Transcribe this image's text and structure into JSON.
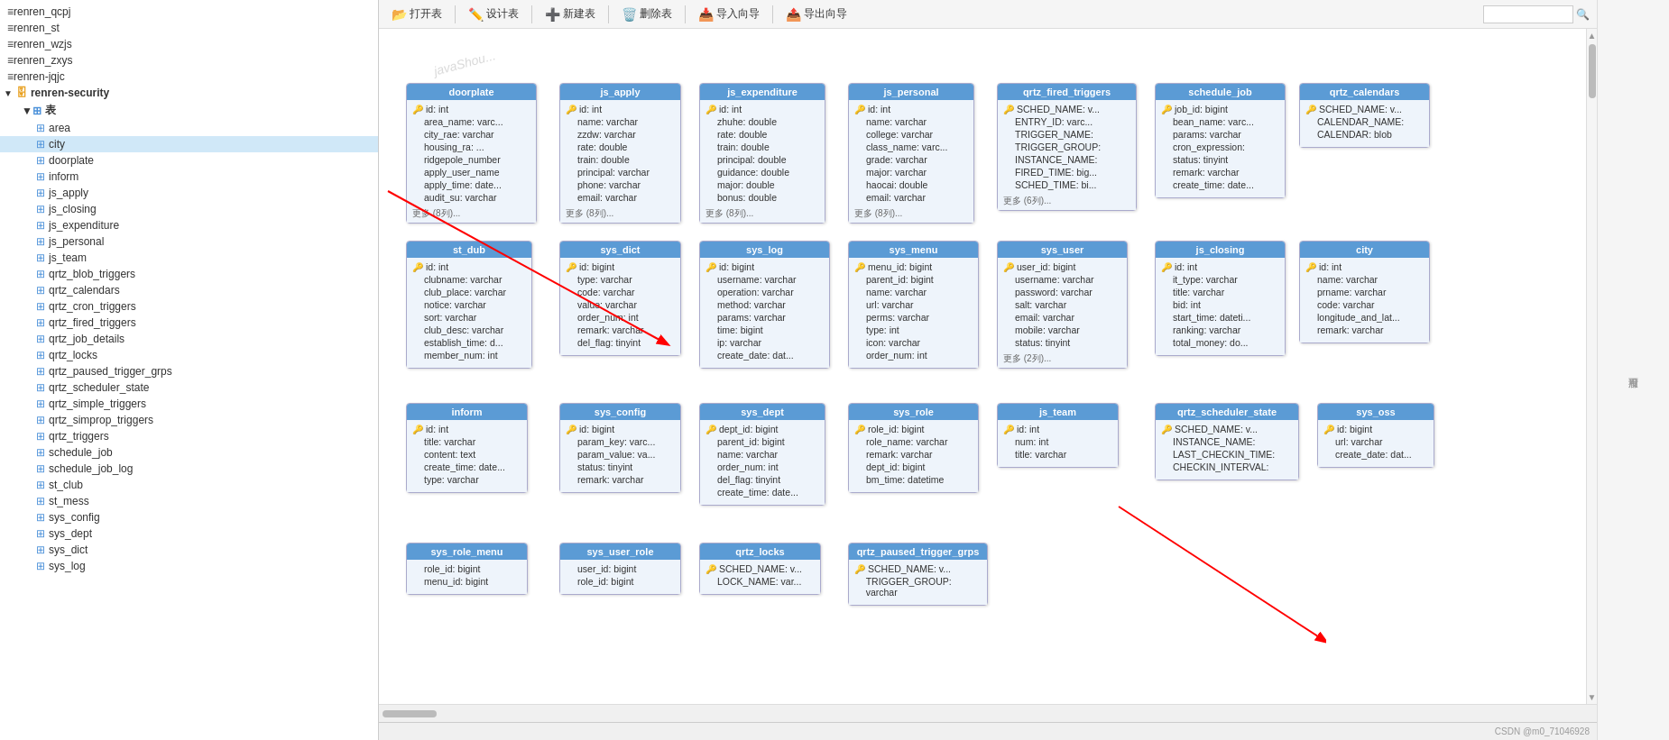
{
  "toolbar": {
    "open_table": "打开表",
    "design_table": "设计表",
    "new_table": "新建表",
    "delete_table": "删除表",
    "import_wizard": "导入向导",
    "export_wizard": "导出向导"
  },
  "sidebar": {
    "tables_label": "表",
    "db_name": "renren-security",
    "items": [
      "renren_qcpj",
      "renren_st",
      "renren_wzjs",
      "renren_zxys",
      "renren-jqjc",
      "renren-security",
      "area",
      "city",
      "doorplate",
      "inform",
      "js_apply",
      "js_closing",
      "js_expenditure",
      "js_personal",
      "js_team",
      "qrtz_blob_triggers",
      "qrtz_calendars",
      "qrtz_cron_triggers",
      "qrtz_fired_triggers",
      "qrtz_job_details",
      "qrtz_locks",
      "qrtz_paused_trigger_grps",
      "qrtz_scheduler_state",
      "qrtz_simple_triggers",
      "qrtz_simprop_triggers",
      "qrtz_triggers",
      "schedule_job",
      "schedule_job_log",
      "st_club",
      "st_mess",
      "sys_config",
      "sys_dept",
      "sys_dict",
      "sys_log"
    ]
  },
  "right_panel": {
    "text": "没有可用"
  },
  "tables": {
    "doorplate": {
      "name": "doorplate",
      "fields": [
        "id: int",
        "area_name: varc...",
        "city_rae: varchar",
        "housing_ra: ...",
        "ridgepole_number",
        "apply_user_name",
        "apply_time: date...",
        "audit_su: varchar"
      ],
      "more": "更多 (8列)..."
    },
    "js_apply": {
      "name": "js_apply",
      "fields": [
        "id: int",
        "name: varchar",
        "zzdw: varchar",
        "rate: double",
        "train: double",
        "principal: varchar",
        "phone: varchar",
        "email: varchar"
      ],
      "more": "更多 (8列)..."
    },
    "js_expenditure": {
      "name": "js_expenditure",
      "fields": [
        "id: int",
        "zhuhe: double",
        "rate: double",
        "train: double",
        "principal: double",
        "guidance: double",
        "major: double",
        "bonus: double"
      ],
      "more": "更多 (8列)..."
    },
    "js_personal": {
      "name": "js_personal",
      "fields": [
        "id: int",
        "name: varchar",
        "college: varchar",
        "class_name: varc...",
        "grade: varchar",
        "major: varchar",
        "haocai: double",
        "email: varchar"
      ],
      "more": "更多 (8列)..."
    },
    "qrtz_fired_triggers": {
      "name": "qrtz_fired_triggers",
      "fields": [
        "SCHED_NAME: v...",
        "ENTRY_ID: varc...",
        "TRIGGER_NAME:",
        "TRIGGER_GROUP:",
        "INSTANCE_NAME:",
        "FIRED_TIME: big...",
        "SCHED_TIME: bi..."
      ],
      "more": "更多 (6列)..."
    },
    "schedule_job": {
      "name": "schedule_job",
      "fields": [
        "job_id: bigint",
        "bean_name: varc...",
        "params: varchar",
        "cron_expression:",
        "status: tinyint",
        "remark: varchar",
        "create_time: date..."
      ],
      "more": ""
    },
    "qrtz_calendars": {
      "name": "qrtz_calendars",
      "fields": [
        "SCHED_NAME: v...",
        "CALENDAR_NAME:",
        "CALENDAR: blob"
      ],
      "more": ""
    },
    "st_dub": {
      "name": "st_dub",
      "fields": [
        "id: int",
        "clubname: varchar",
        "club_place: varchar",
        "notice: varchar",
        "sort: varchar",
        "club_desc: varchar",
        "establish_time: d...",
        "member_num: int"
      ],
      "more": ""
    },
    "sys_dict": {
      "name": "sys_dict",
      "fields": [
        "id: bigint",
        "type: varchar",
        "code: varchar",
        "value: varchar",
        "order_num: int",
        "remark: varchar",
        "del_flag: tinyint"
      ],
      "more": ""
    },
    "sys_log": {
      "name": "sys_log",
      "fields": [
        "id: bigint",
        "username: varchar",
        "operation: varchar",
        "method: varchar",
        "params: varchar",
        "time: bigint",
        "ip: varchar",
        "create_date: dat..."
      ],
      "more": ""
    },
    "sys_menu": {
      "name": "sys_menu",
      "fields": [
        "menu_id: bigint",
        "parent_id: bigint",
        "name: varchar",
        "url: varchar",
        "perms: varchar",
        "type: int",
        "icon: varchar",
        "order_num: int"
      ],
      "more": ""
    },
    "sys_user": {
      "name": "sys_user",
      "fields": [
        "user_id: bigint",
        "username: varchar",
        "password: varchar",
        "salt: varchar",
        "email: varchar",
        "mobile: varchar",
        "status: tinyint"
      ],
      "more": "更多 (2列)..."
    },
    "js_closing": {
      "name": "js_closing",
      "fields": [
        "id: int",
        "it_type: varchar",
        "title: varchar",
        "bid: int",
        "start_time: dateti...",
        "ranking: varchar",
        "total_money: do..."
      ],
      "more": ""
    },
    "city": {
      "name": "city",
      "fields": [
        "id: int",
        "name: varchar",
        "prname: varchar",
        "code: varchar",
        "longitude_and_lat...",
        "remark: varchar"
      ],
      "more": ""
    },
    "inform": {
      "name": "inform",
      "fields": [
        "id: int",
        "title: varchar",
        "content: text",
        "create_time: date...",
        "type: varchar"
      ],
      "more": ""
    },
    "sys_config": {
      "name": "sys_config",
      "fields": [
        "id: bigint",
        "param_key: varc...",
        "param_value: va...",
        "status: tinyint",
        "remark: varchar"
      ],
      "more": ""
    },
    "sys_dept": {
      "name": "sys_dept",
      "fields": [
        "dept_id: bigint",
        "parent_id: bigint",
        "name: varchar",
        "order_num: int",
        "del_flag: tinyint",
        "create_time: date..."
      ],
      "more": ""
    },
    "sys_role": {
      "name": "sys_role",
      "fields": [
        "role_id: bigint",
        "role_name: varchar",
        "remark: varchar",
        "dept_id: bigint",
        "bm_time: datetime"
      ],
      "more": ""
    },
    "js_team": {
      "name": "js_team",
      "fields": [
        "id: int",
        "num: int",
        "title: varchar"
      ],
      "more": ""
    },
    "qrtz_scheduler_state": {
      "name": "qrtz_scheduler_state",
      "fields": [
        "SCHED_NAME: v...",
        "INSTANCE_NAME:",
        "LAST_CHECKIN_TIME:",
        "CHECKIN_INTERVAL:"
      ],
      "more": ""
    },
    "sys_oss": {
      "name": "sys_oss",
      "fields": [
        "id: bigint",
        "url: varchar",
        "create_date: dat..."
      ],
      "more": ""
    },
    "sys_role_menu": {
      "name": "sys_role_menu",
      "fields": [
        "role_id: bigint",
        "menu_id: bigint"
      ],
      "more": ""
    },
    "sys_user_role": {
      "name": "sys_user_role",
      "fields": [
        "user_id: bigint",
        "role_id: bigint"
      ],
      "more": ""
    },
    "qrtz_locks": {
      "name": "qrtz_locks",
      "fields": [
        "SCHED_NAME: v...",
        "LOCK_NAME: var..."
      ],
      "more": ""
    },
    "qrtz_paused_trigger_grps": {
      "name": "qrtz_paused_trigger_grps",
      "fields": [
        "SCHED_NAME: v...",
        "TRIGGER_GROUP: varchar"
      ],
      "more": ""
    }
  },
  "statusbar": {
    "csdn": "CSDN @m0_71046928"
  }
}
